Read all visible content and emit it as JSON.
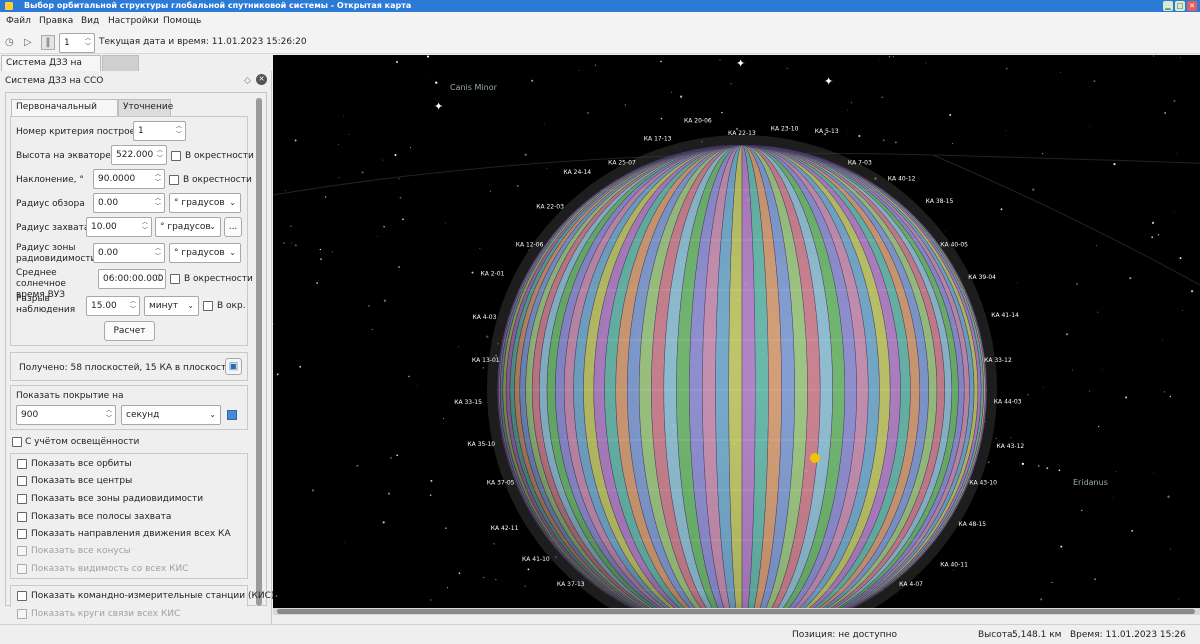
{
  "window": {
    "title": "Выбор орбитальной структуры глобальной спутниковой системы - Открытая карта"
  },
  "menu": [
    "Файл",
    "Правка",
    "Вид",
    "Настройки",
    "Помощь"
  ],
  "toolbar": {
    "step": "1",
    "datetime": "Текущая дата и время: 11.01.2023 15:26:20"
  },
  "doc_tab": "Система ДЗЗ на ССО",
  "dock": {
    "title": "Система ДЗЗ на ССО"
  },
  "tabs": [
    "Первоначальный расчет",
    "Уточнение"
  ],
  "form": {
    "criterion_label": "Номер критерия построения",
    "criterion_value": "1",
    "height_label": "Высота на экваторе, км",
    "height_value": "522.000",
    "height_neigh": "В окрестности",
    "incl_label": "Наклонение, °",
    "incl_value": "90.0000",
    "incl_neigh": "В окрестности",
    "view_label": "Радиус обзора",
    "view_value": "0.00",
    "view_unit": "° градусов",
    "capture_label": "Радиус захвата",
    "capture_value": "10.00",
    "capture_unit": "° градусов",
    "capture_more": "...",
    "radio_label": "Радиус зоны радиовидимости",
    "radio_value": "0.00",
    "radio_unit": "° градусов",
    "solar_label": "Среднее солнечное время ВУЗ",
    "solar_value": "06:00:00.000",
    "solar_neigh": "В окрестности",
    "gap_label": "Разрыв наблюдения",
    "gap_value": "15.00",
    "gap_unit": "минут",
    "gap_neigh": "В окр.",
    "calc_button": "Расчет"
  },
  "result": "Получено: 58 плоскостей, 15 КА в плоскости",
  "coverage": {
    "label": "Показать  покрытие на",
    "value": "900",
    "unit": "секунд"
  },
  "lighting": "С учётом освещённости",
  "options": [
    {
      "label": "Показать все орбиты",
      "enabled": true
    },
    {
      "label": "Показать все центры",
      "enabled": true
    },
    {
      "label": "Показать все зоны радиовидимости",
      "enabled": true
    },
    {
      "label": "Показать все полосы захвата",
      "enabled": true
    },
    {
      "label": "Показать направления движения всех КА",
      "enabled": true
    },
    {
      "label": "Показать все конусы",
      "enabled": false
    },
    {
      "label": "Показать видимость со всех КИС",
      "enabled": false
    }
  ],
  "stations": [
    {
      "label": "Показать командно-измерительные станции (КИС)",
      "enabled": true
    },
    {
      "label": "Показать круги связи всех КИС",
      "enabled": false
    }
  ],
  "sky": {
    "labels": [
      "Canis Minor",
      "Eridanus"
    ]
  },
  "sat_labels": [
    "КА 22-13",
    "КА 23-10",
    "КА 5-13",
    "КА 7-03",
    "КА 40-12",
    "КА 38-15",
    "КА 40-05",
    "КА 39-04",
    "КА 41-14",
    "КА 33-12",
    "КА 44-03",
    "КА 43-12",
    "КА 43-10",
    "КА 48-15",
    "КА 40-11",
    "КА 4-07",
    "КА 1-11",
    "КА 1-04",
    "КА 2-13",
    "КА 46-02",
    "КА 42-12",
    "КА 40-02",
    "КА 41-03",
    "КА 42-04",
    "КА 37-13",
    "КА 41-10",
    "КА 42-11",
    "КА 37-05",
    "КА 35-10",
    "КА 33-15",
    "КА 13-01",
    "КА 4-03",
    "КА 2-01",
    "КА 12-06",
    "КА 22-03",
    "КА 24-14",
    "КА 25-07",
    "КА 17-13",
    "КА 20-06"
  ],
  "statusbar": {
    "position": "Позиция: не доступно",
    "height": "Высота:",
    "height_value": "5,148.1 км",
    "time": "Время: 11.01.2023 15:26"
  }
}
